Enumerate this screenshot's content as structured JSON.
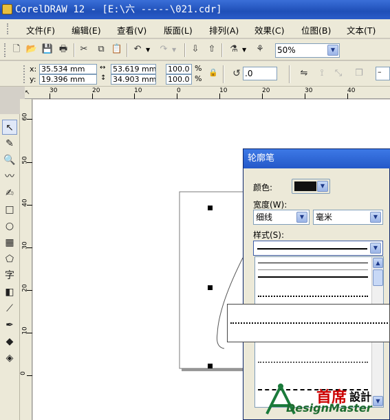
{
  "window": {
    "title": "CorelDRAW 12 - [E:\\六  -----\\021.cdr]"
  },
  "menu": [
    "文件(F)",
    "编辑(E)",
    "查看(V)",
    "版面(L)",
    "排列(A)",
    "效果(C)",
    "位图(B)",
    "文本(T)"
  ],
  "toolbar": {
    "zoom": "50%"
  },
  "property_bar": {
    "x_label": "x:",
    "x_value": "35.534 mm",
    "y_label": "y:",
    "y_value": "19.396 mm",
    "width_value": "53.619 mm",
    "height_value": "34.903 mm",
    "scale_x": "100.0",
    "scale_y": "100.0",
    "percent": "%",
    "rotation": ".0"
  },
  "ruler": {
    "h_labels": [
      "30",
      "20",
      "10",
      "0",
      "10",
      "20",
      "30",
      "40"
    ],
    "v_labels": [
      "60",
      "50",
      "40",
      "30",
      "20",
      "10",
      "0"
    ]
  },
  "dialog": {
    "title": "轮廓笔",
    "color_label": "颜色:",
    "color_value": "#111111",
    "width_label": "宽度(W):",
    "width_value": "细线",
    "unit_value": "毫米",
    "style_label": "样式(S):"
  },
  "watermark": {
    "brand_cn": "首席",
    "brand_cn2": "設計",
    "brand_en": "DesignMaster"
  }
}
